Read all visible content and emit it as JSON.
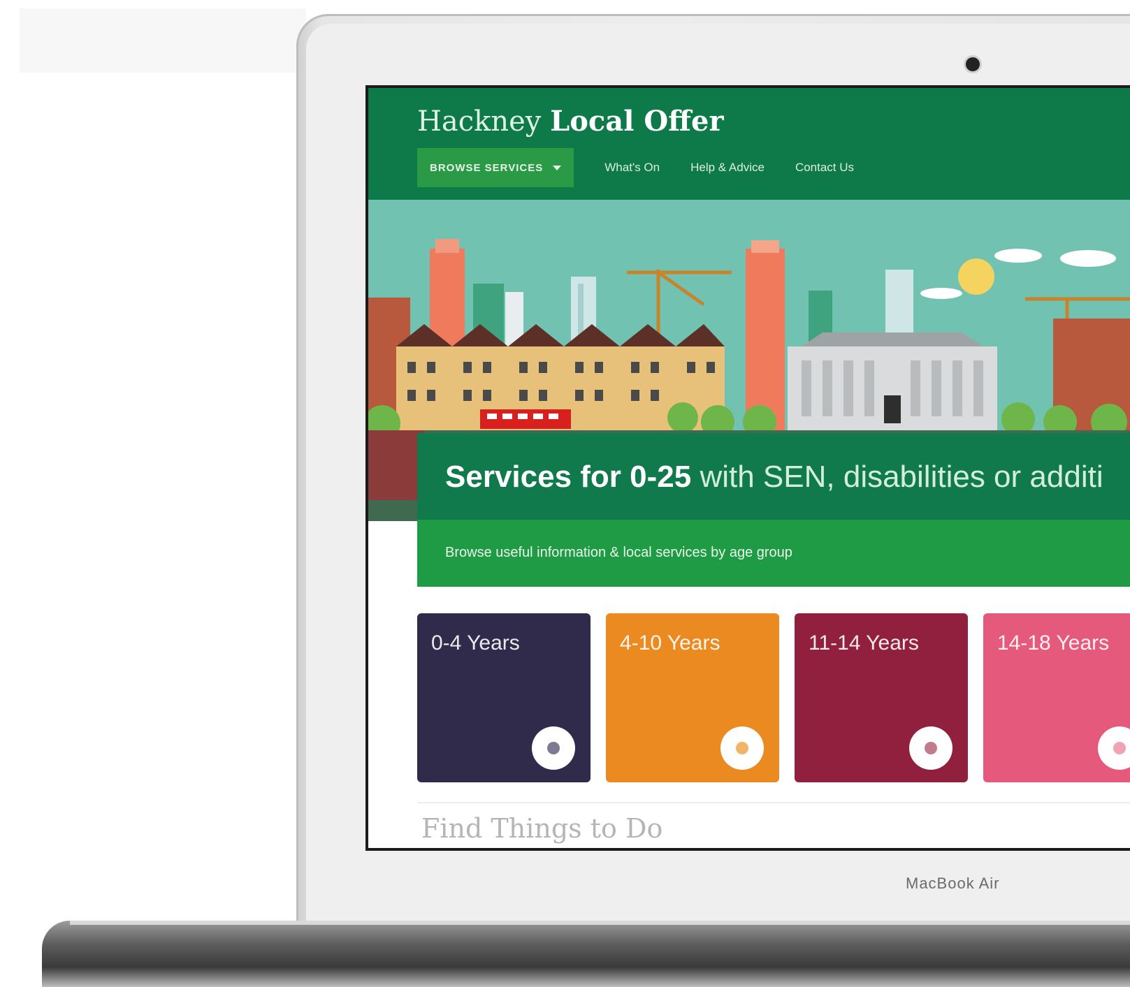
{
  "site": {
    "title_light": "Hackney",
    "title_bold": "Local Offer"
  },
  "nav": {
    "browse_label": "BROWSE SERVICES",
    "links": [
      "What's On",
      "Help & Advice",
      "Contact Us"
    ]
  },
  "hero": {
    "headline_strong": "Services for 0-25",
    "headline_rest": "with SEN, disabilities or additi",
    "subtext": "Browse useful information & local services by age group"
  },
  "age_tiles": [
    {
      "label": "0-4 Years",
      "color": "#302b4b",
      "dot": "#7d7a93"
    },
    {
      "label": "4-10 Years",
      "color": "#ea8a21",
      "dot": "#f1b46a"
    },
    {
      "label": "11-14 Years",
      "color": "#911f3e",
      "dot": "#c27b8c"
    },
    {
      "label": "14-18 Years",
      "color": "#e55a7c",
      "dot": "#f0a3b5"
    }
  ],
  "section": {
    "heading": "Find Things to Do"
  },
  "device": {
    "brand": "MacBook Air"
  },
  "colors": {
    "header_green": "#0f7a49",
    "accent_green": "#1f9a45",
    "hero_sky": "#72c2b2"
  }
}
